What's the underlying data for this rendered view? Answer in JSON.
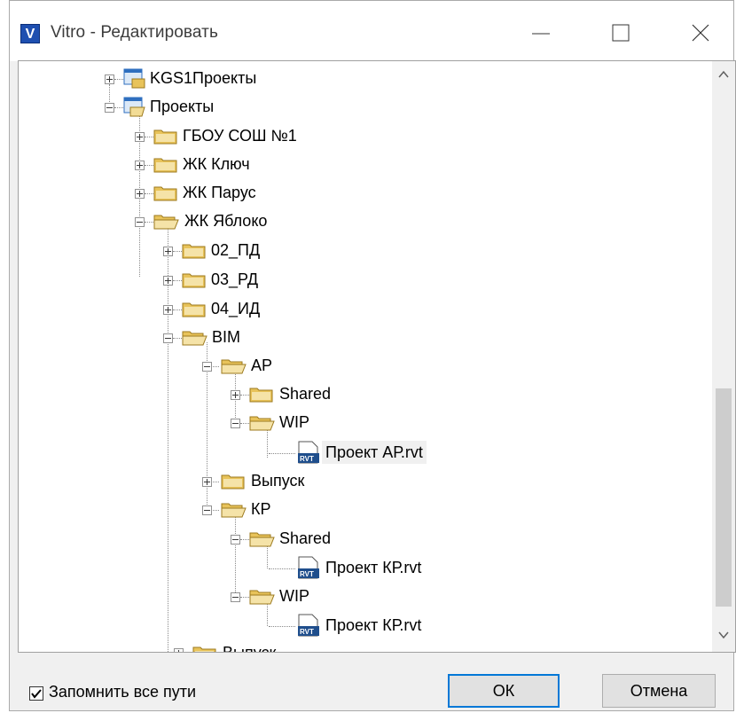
{
  "window": {
    "title": "Vitro - Редактировать",
    "app_icon_letter": "V",
    "controls": [
      "minimize-icon",
      "maximize-icon",
      "close-icon"
    ]
  },
  "tree": {
    "nodes": [
      {
        "label": "KGS1Проекты",
        "type": "project",
        "expanded": false
      },
      {
        "label": "Проекты",
        "type": "project",
        "expanded": true
      },
      {
        "label": "ГБОУ СОШ №1",
        "type": "folder",
        "expanded": false
      },
      {
        "label": "ЖК Ключ",
        "type": "folder",
        "expanded": false
      },
      {
        "label": "ЖК Парус",
        "type": "folder",
        "expanded": false
      },
      {
        "label": "ЖК Яблоко",
        "type": "folder",
        "expanded": true
      },
      {
        "label": "02_ПД",
        "type": "folder",
        "expanded": false
      },
      {
        "label": "03_РД",
        "type": "folder",
        "expanded": false
      },
      {
        "label": "04_ИД",
        "type": "folder",
        "expanded": false
      },
      {
        "label": "BIM",
        "type": "folder",
        "expanded": true
      },
      {
        "label": "АР",
        "type": "folder",
        "expanded": true
      },
      {
        "label": "Shared",
        "type": "folder",
        "expanded": false
      },
      {
        "label": "WIP",
        "type": "folder",
        "expanded": true
      },
      {
        "label": "Проект АР.rvt",
        "type": "file",
        "selected": true
      },
      {
        "label": "Выпуск",
        "type": "folder",
        "expanded": false
      },
      {
        "label": "КР",
        "type": "folder",
        "expanded": true
      },
      {
        "label": "Shared",
        "type": "folder",
        "expanded": true
      },
      {
        "label": "Проект КР.rvt",
        "type": "file"
      },
      {
        "label": "WIP",
        "type": "folder",
        "expanded": true
      },
      {
        "label": "Проект КР.rvt",
        "type": "file"
      },
      {
        "label": "Выпуск",
        "type": "folder",
        "expanded": false
      }
    ],
    "file_icon_text": "RVT"
  },
  "footer": {
    "remember_paths_label": "Запомнить все пути",
    "remember_paths_checked": true,
    "ok_label": "ОК",
    "cancel_label": "Отмена"
  },
  "colors": {
    "folder": "#e8c35a",
    "project_icon": "#2f6fbf",
    "selection": "#f0f0f0",
    "default_button_border": "#0078d7"
  }
}
